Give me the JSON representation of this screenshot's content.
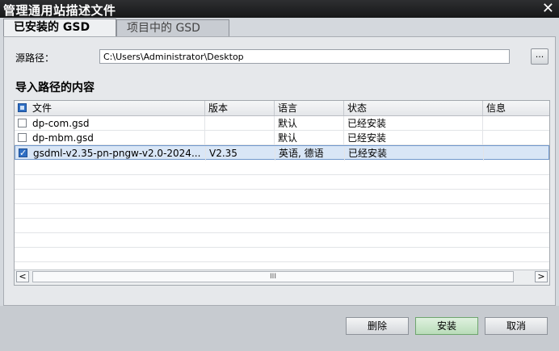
{
  "window": {
    "title": "管理通用站描述文件",
    "close_glyph": "✕"
  },
  "tabs": [
    {
      "label": "已安装的 GSD"
    },
    {
      "label": "项目中的 GSD"
    }
  ],
  "source": {
    "label": "源路径：",
    "value": "C:\\Users\\Administrator\\Desktop",
    "browse_label": "..."
  },
  "section": {
    "title": "导入路径的内容"
  },
  "table": {
    "columns": [
      "文件",
      "版本",
      "语言",
      "状态",
      "信息"
    ],
    "rows": [
      {
        "file": "dp-com.gsd",
        "version": "",
        "language": "默认",
        "status": "已经安装",
        "info": "",
        "checked": false
      },
      {
        "file": "dp-mbm.gsd",
        "version": "",
        "language": "默认",
        "status": "已经安装",
        "info": "",
        "checked": false
      },
      {
        "file": "gsdml-v2.35-pn-pngw-v2.0-2024...",
        "version": "V2.35",
        "language": "英语, 德语",
        "status": "已经安装",
        "info": "",
        "checked": true
      }
    ]
  },
  "scroll": {
    "left_icon": "<",
    "right_icon": ">",
    "thumb_grip": "III"
  },
  "buttons": {
    "delete": "删除",
    "install": "安装",
    "cancel": "取消"
  }
}
